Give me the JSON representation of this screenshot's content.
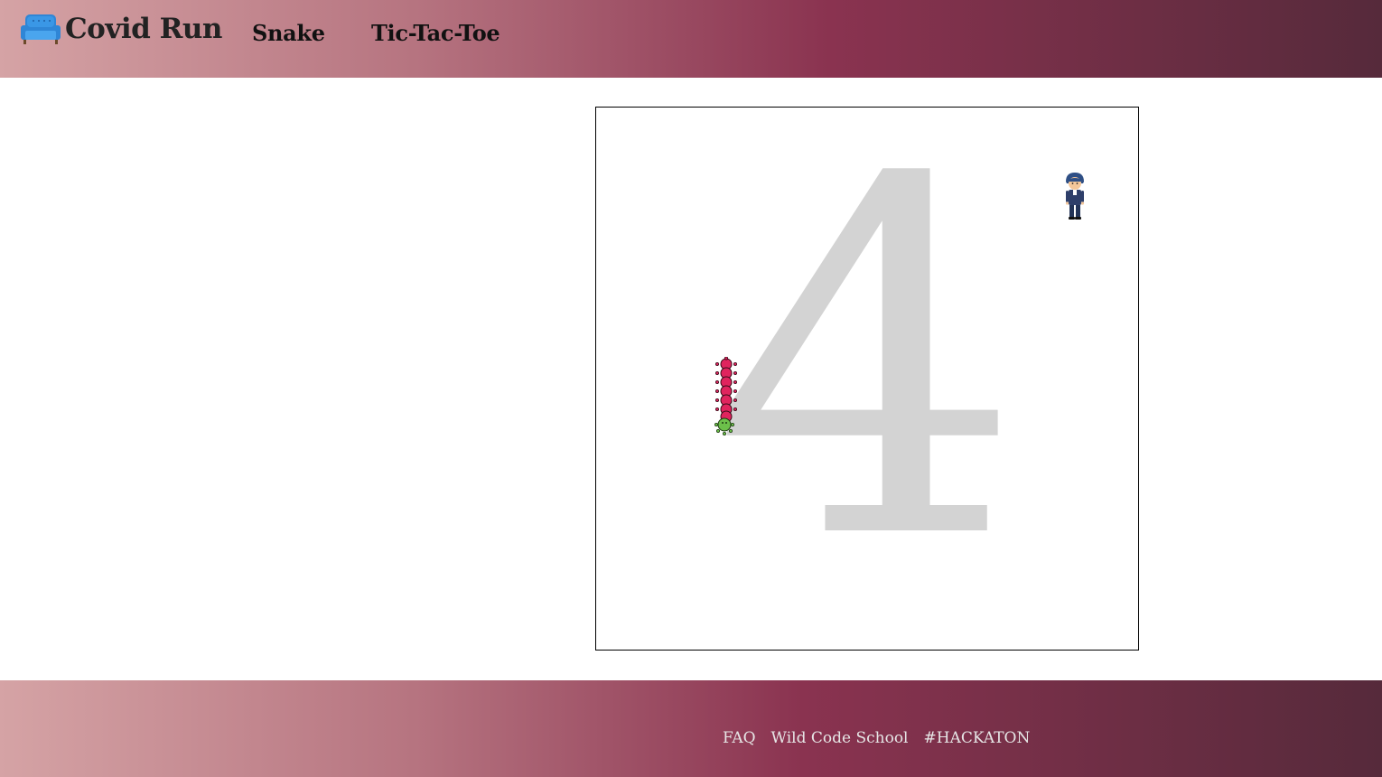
{
  "header": {
    "brand_title": "Covid Run",
    "brand_icon": "couch-icon",
    "nav": [
      {
        "label": "Snake"
      },
      {
        "label": "Tic-Tac-Toe"
      }
    ]
  },
  "game": {
    "countdown": "4",
    "countdown_color": "#d3d3d3",
    "snake_color": "#e0245e",
    "snake_head_color": "#6cc04a",
    "player_icon": "person-icon"
  },
  "footer": {
    "links": [
      {
        "label": "FAQ"
      },
      {
        "label": "Wild Code School"
      },
      {
        "label": "#HACKATON"
      }
    ]
  }
}
